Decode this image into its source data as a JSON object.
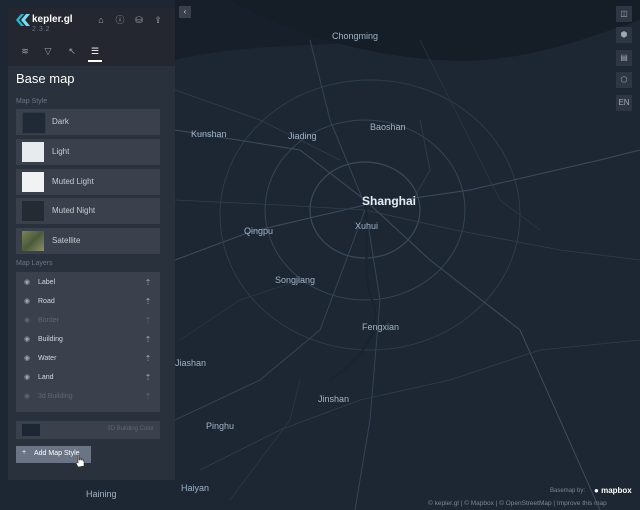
{
  "app": {
    "brand": "kepler.gl",
    "version": "2.3.2",
    "header_icons": [
      "tutorial-icon",
      "info-icon",
      "database-icon",
      "share-icon"
    ],
    "tabs": [
      {
        "name": "layers-tab",
        "icon": "layers-icon"
      },
      {
        "name": "filters-tab",
        "icon": "filter-icon"
      },
      {
        "name": "interactions-tab",
        "icon": "cursor-icon"
      },
      {
        "name": "base-map-tab",
        "icon": "sliders-icon",
        "active": true
      }
    ]
  },
  "panel": {
    "title": "Base map",
    "map_style_label": "Map Style",
    "styles": [
      {
        "label": "Dark",
        "thumb_color": "#1f2a36"
      },
      {
        "label": "Light",
        "thumb_color": "#e8ebee"
      },
      {
        "label": "Muted Light",
        "thumb_color": "#f1f2f3"
      },
      {
        "label": "Muted Night",
        "thumb_color": "#252b33"
      },
      {
        "label": "Satellite",
        "thumb_color": "#5d6a45"
      }
    ],
    "map_layers_label": "Map Layers",
    "layers": [
      {
        "label": "Label",
        "visible": true
      },
      {
        "label": "Road",
        "visible": true
      },
      {
        "label": "Border",
        "visible": false
      },
      {
        "label": "Building",
        "visible": true
      },
      {
        "label": "Water",
        "visible": true
      },
      {
        "label": "Land",
        "visible": true
      },
      {
        "label": "3d Building",
        "visible": false
      }
    ],
    "building_color_label": "3D Building Color",
    "add_button": {
      "plus": "+",
      "label": "Add Map Style"
    }
  },
  "map": {
    "cities": [
      {
        "name": "Chongming"
      },
      {
        "name": "Kunshan"
      },
      {
        "name": "Jiading"
      },
      {
        "name": "Baoshan"
      },
      {
        "name": "Shanghai",
        "major": true
      },
      {
        "name": "Qingpu"
      },
      {
        "name": "Xuhui"
      },
      {
        "name": "Songjiang"
      },
      {
        "name": "Fengxian"
      },
      {
        "name": "Jiashan"
      },
      {
        "name": "Jinshan"
      },
      {
        "name": "Pinghu"
      },
      {
        "name": "Haiyan"
      },
      {
        "name": "Haining"
      }
    ]
  },
  "map_controls": [
    {
      "name": "split-map-button",
      "icon": "split-icon",
      "glyph": "◫"
    },
    {
      "name": "3d-map-button",
      "icon": "cube-icon",
      "glyph": "⬢"
    },
    {
      "name": "legend-button",
      "icon": "legend-icon",
      "glyph": "▤"
    },
    {
      "name": "draw-button",
      "icon": "polygon-icon",
      "glyph": "⬠"
    },
    {
      "name": "locale-button",
      "icon": "locale-icon",
      "glyph": "EN"
    }
  ],
  "attribution": {
    "basemap_by": "Basemap by:",
    "mapbox": "mapbox",
    "text": "© kepler.gl | © Mapbox | © OpenStreetMap | Improve this map"
  },
  "colors": {
    "panel_bg": "#29323c",
    "header_bg": "#242730",
    "item_bg": "#3a414c",
    "map_bg": "#1d2733",
    "accent": "#6a7485"
  }
}
